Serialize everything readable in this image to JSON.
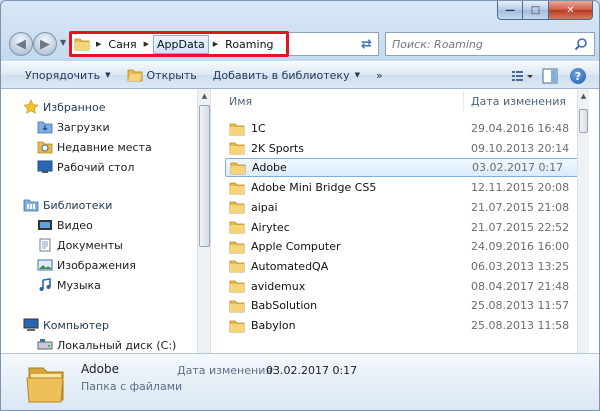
{
  "window": {
    "controls": {
      "minimize": "—",
      "maximize": "□",
      "close": "✕"
    }
  },
  "address_bar": {
    "breadcrumbs": [
      "Саня",
      "AppData",
      "Roaming"
    ],
    "active_index": 1
  },
  "search": {
    "placeholder": "Поиск: Roaming"
  },
  "toolbar": {
    "organize": "Упорядочить",
    "open": "Открыть",
    "add_to_library": "Добавить в библиотеку"
  },
  "nav": {
    "favorites": {
      "title": "Избранное",
      "items": [
        "Загрузки",
        "Недавние места",
        "Рабочий стол"
      ]
    },
    "libraries": {
      "title": "Библиотеки",
      "items": [
        "Видео",
        "Документы",
        "Изображения",
        "Музыка"
      ]
    },
    "computer": {
      "title": "Компьютер",
      "items": [
        "Локальный диск (C:)"
      ]
    }
  },
  "files": {
    "columns": {
      "name": "Имя",
      "date": "Дата изменения"
    },
    "rows": [
      {
        "name": "1C",
        "date": "29.04.2016 16:48"
      },
      {
        "name": "2K Sports",
        "date": "09.10.2013 20:14"
      },
      {
        "name": "Adobe",
        "date": "03.02.2017 0:17",
        "selected": true
      },
      {
        "name": "Adobe Mini Bridge CS5",
        "date": "12.11.2015 20:08"
      },
      {
        "name": "aipai",
        "date": "21.07.2015 21:08"
      },
      {
        "name": "Airytec",
        "date": "21.07.2015 22:52"
      },
      {
        "name": "Apple Computer",
        "date": "24.09.2016 16:00"
      },
      {
        "name": "AutomatedQA",
        "date": "06.03.2013 13:25"
      },
      {
        "name": "avidemux",
        "date": "08.04.2017 21:48"
      },
      {
        "name": "BabSolution",
        "date": "25.08.2013 11:57"
      },
      {
        "name": "Babylon",
        "date": "25.08.2013 11:58"
      }
    ]
  },
  "details": {
    "name": "Adobe",
    "type": "Папка с файлами",
    "date_label": "Дата изменения:",
    "date": "03.02.2017 0:17"
  },
  "colors": {
    "highlight_box": "#e1151e",
    "selection_border": "#84acdd",
    "folder": "#e9b84a"
  }
}
